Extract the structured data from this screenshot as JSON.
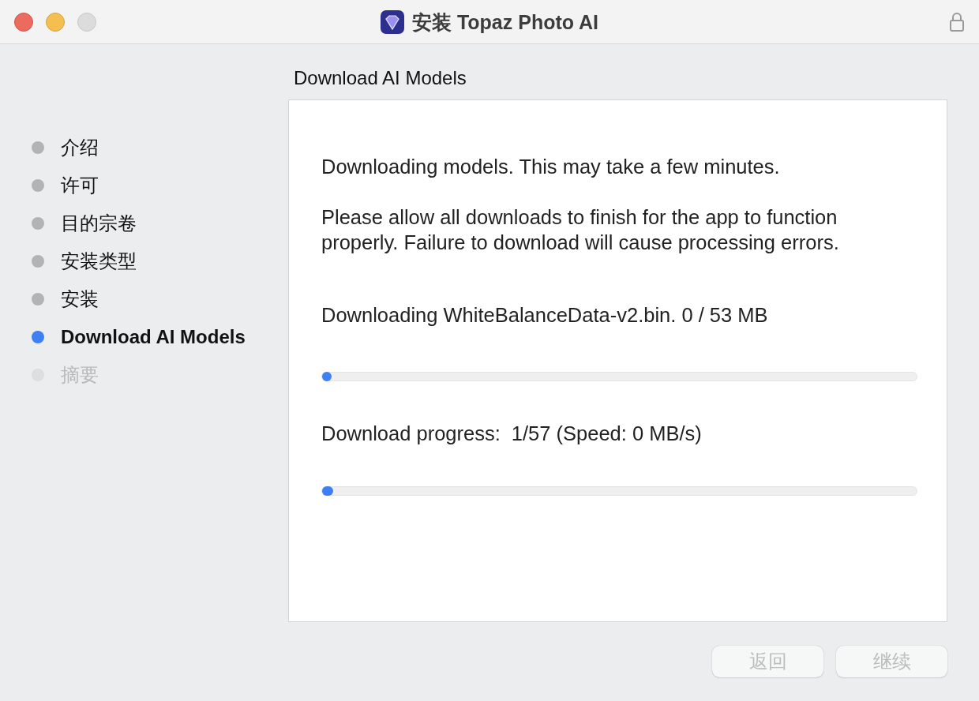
{
  "window": {
    "title": "安装 Topaz Photo AI"
  },
  "steps": [
    {
      "label": "介绍",
      "selected": false,
      "disabled": false
    },
    {
      "label": "许可",
      "selected": false,
      "disabled": false
    },
    {
      "label": "目的宗卷",
      "selected": false,
      "disabled": false
    },
    {
      "label": "安装类型",
      "selected": false,
      "disabled": false
    },
    {
      "label": "安装",
      "selected": false,
      "disabled": false
    },
    {
      "label": "Download AI Models",
      "selected": true,
      "disabled": false
    },
    {
      "label": "摘要",
      "selected": false,
      "disabled": true
    }
  ],
  "page_title": "Download AI Models",
  "panel": {
    "intro": "Downloading models. This may take a few minutes.",
    "notice": "Please allow all downloads to finish for the app to function properly. Failure to download will cause processing errors.",
    "file_status": "Downloading WhiteBalanceData-v2.bin. 0 / 53 MB",
    "file_progress": {
      "level": 0.0
    },
    "overall_label": "Download progress:",
    "overall_value": "1/57 (Speed: 0 MB/s)",
    "overall_progress": {
      "level": 0.018
    }
  },
  "buttons": [
    {
      "label": "返回",
      "disabled": true
    },
    {
      "label": "继续",
      "disabled": true
    }
  ]
}
